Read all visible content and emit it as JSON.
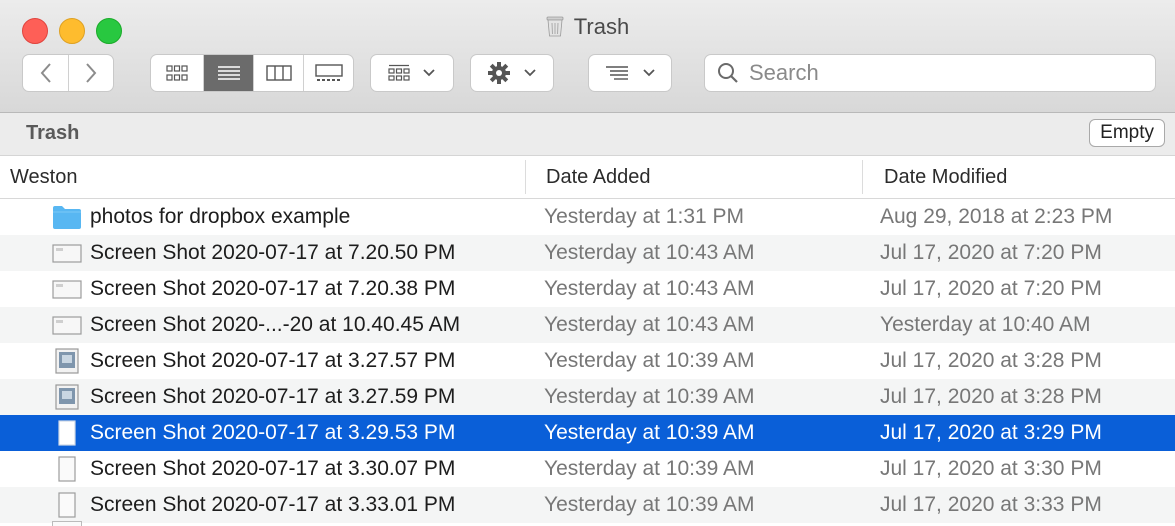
{
  "window": {
    "title": "Trash"
  },
  "toolbar": {
    "search_placeholder": "Search"
  },
  "pathbar": {
    "label": "Trash",
    "empty_label": "Empty"
  },
  "columns": {
    "name": "Weston",
    "date_added": "Date Added",
    "date_modified": "Date Modified"
  },
  "files": [
    {
      "name": "photos for dropbox example",
      "date_added": "Yesterday at 1:31 PM",
      "date_modified": "Aug 29, 2018 at 2:23 PM",
      "icon": "folder-icon"
    },
    {
      "name": "Screen Shot 2020-07-17 at 7.20.50 PM",
      "date_added": "Yesterday at 10:43 AM",
      "date_modified": "Jul 17, 2020 at 7:20 PM",
      "icon": "screenshot-file-icon"
    },
    {
      "name": "Screen Shot 2020-07-17 at 7.20.38 PM",
      "date_added": "Yesterday at 10:43 AM",
      "date_modified": "Jul 17, 2020 at 7:20 PM",
      "icon": "screenshot-file-icon"
    },
    {
      "name": "Screen Shot 2020-...-20 at 10.40.45 AM",
      "date_added": "Yesterday at 10:43 AM",
      "date_modified": "Yesterday at 10:40 AM",
      "icon": "screenshot-file-icon"
    },
    {
      "name": "Screen Shot 2020-07-17 at 3.27.57 PM",
      "date_added": "Yesterday at 10:39 AM",
      "date_modified": "Jul 17, 2020 at 3:28 PM",
      "icon": "image-file-icon"
    },
    {
      "name": "Screen Shot 2020-07-17 at 3.27.59 PM",
      "date_added": "Yesterday at 10:39 AM",
      "date_modified": "Jul 17, 2020 at 3:28 PM",
      "icon": "image-file-icon"
    },
    {
      "name": "Screen Shot 2020-07-17 at 3.29.53 PM",
      "date_added": "Yesterday at 10:39 AM",
      "date_modified": "Jul 17, 2020 at 3:29 PM",
      "icon": "document-file-icon",
      "selected": true
    },
    {
      "name": "Screen Shot 2020-07-17 at 3.30.07 PM",
      "date_added": "Yesterday at 10:39 AM",
      "date_modified": "Jul 17, 2020 at 3:30 PM",
      "icon": "document-file-icon"
    },
    {
      "name": "Screen Shot 2020-07-17 at 3.33.01 PM",
      "date_added": "Yesterday at 10:39 AM",
      "date_modified": "Jul 17, 2020 at 3:33 PM",
      "icon": "document-file-icon"
    }
  ],
  "colors": {
    "selection": "#0a5fd8",
    "folder": "#58b7f2",
    "close": "#fe5f57",
    "minimize": "#febc2e",
    "zoom": "#28c840"
  }
}
